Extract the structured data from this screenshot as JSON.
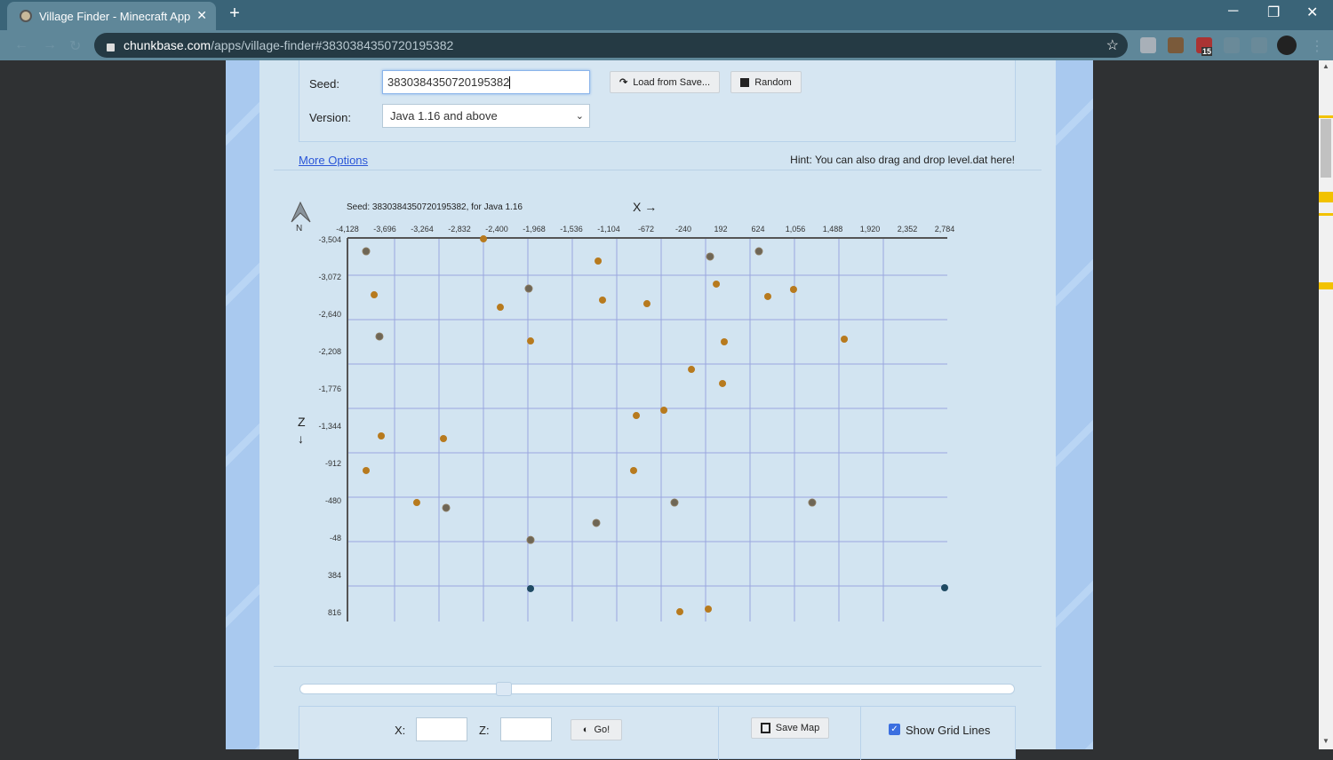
{
  "browser": {
    "tab_title": "Village Finder - Minecraft App",
    "tab_close": "✕",
    "new_tab": "+",
    "url_host": "chunkbase.com",
    "url_path": "/apps/village-finder#3830384350720195382",
    "extension_badge": "15",
    "window_controls": {
      "minimize": "─",
      "restore": "❐",
      "close": "✕"
    }
  },
  "form": {
    "seed_label": "Seed:",
    "seed_value": "3830384350720195382",
    "version_label": "Version:",
    "version_value": "Java 1.16 and above",
    "load_button": "Load from Save...",
    "random_button": "Random",
    "more_options": "More Options",
    "hint": "Hint: You can also drag and drop level.dat here!"
  },
  "chart_data": {
    "type": "scatter",
    "title": "Seed: 3830384350720195382, for Java 1.16",
    "xlabel": "X →",
    "ylabel": "Z ↓",
    "compass": "N",
    "x_ticks": [
      -4128,
      -3696,
      -3264,
      -2832,
      -2400,
      -1968,
      -1536,
      -1104,
      -672,
      -240,
      192,
      624,
      1056,
      1488,
      1920,
      2352,
      2784
    ],
    "z_ticks": [
      -3504,
      -3072,
      -2640,
      -2208,
      -1776,
      -1344,
      -912,
      -480,
      -48,
      384,
      816
    ],
    "xlim": [
      -4128,
      2784
    ],
    "zlim": [
      -3504,
      902
    ],
    "grid": true,
    "colors": {
      "village": "#b77a1e",
      "abandoned": "#6e6656",
      "blue": "#1f4a63",
      "grid": "#9aa6de"
    },
    "points": [
      {
        "x": -3912,
        "z": -3370,
        "type": "abandoned"
      },
      {
        "x": -3819,
        "z": -2866,
        "type": "village"
      },
      {
        "x": -3758,
        "z": -2383,
        "type": "abandoned"
      },
      {
        "x": -3737,
        "z": -1231,
        "type": "village"
      },
      {
        "x": -3912,
        "z": -830,
        "type": "village"
      },
      {
        "x": -3326,
        "z": -459,
        "type": "village"
      },
      {
        "x": -3017,
        "z": -1200,
        "type": "village"
      },
      {
        "x": -2986,
        "z": -398,
        "type": "abandoned"
      },
      {
        "x": -2554,
        "z": -3514,
        "type": "village"
      },
      {
        "x": -2359,
        "z": -2722,
        "type": "village"
      },
      {
        "x": -2030,
        "z": -2938,
        "type": "abandoned"
      },
      {
        "x": -2009,
        "z": -2331,
        "type": "village"
      },
      {
        "x": -2009,
        "z": -26,
        "type": "abandoned"
      },
      {
        "x": -2009,
        "z": 538,
        "type": "blue"
      },
      {
        "x": -1227,
        "z": -3257,
        "type": "village"
      },
      {
        "x": -1176,
        "z": -2805,
        "type": "village"
      },
      {
        "x": -1248,
        "z": -223,
        "type": "abandoned"
      },
      {
        "x": -785,
        "z": -1467,
        "type": "village"
      },
      {
        "x": -816,
        "z": -830,
        "type": "village"
      },
      {
        "x": -662,
        "z": -2763,
        "type": "village"
      },
      {
        "x": -466,
        "z": -1529,
        "type": "village"
      },
      {
        "x": -343,
        "z": -459,
        "type": "abandoned"
      },
      {
        "x": -281,
        "z": 806,
        "type": "village"
      },
      {
        "x": -147,
        "z": -2002,
        "type": "village"
      },
      {
        "x": 48,
        "z": 775,
        "type": "village"
      },
      {
        "x": 69,
        "z": -3309,
        "type": "abandoned"
      },
      {
        "x": 141,
        "z": -2990,
        "type": "village"
      },
      {
        "x": 233,
        "z": -2321,
        "type": "village"
      },
      {
        "x": 213,
        "z": -1838,
        "type": "village"
      },
      {
        "x": 634,
        "z": -3370,
        "type": "abandoned"
      },
      {
        "x": 737,
        "z": -2846,
        "type": "village"
      },
      {
        "x": 1035,
        "z": -2928,
        "type": "village"
      },
      {
        "x": 1251,
        "z": -459,
        "type": "abandoned"
      },
      {
        "x": 1622,
        "z": -2352,
        "type": "village"
      },
      {
        "x": 2784,
        "z": 528,
        "type": "blue"
      }
    ]
  },
  "controls": {
    "zoom_slider_percent": 28,
    "x_label": "X:",
    "z_label": "Z:",
    "x_value": "",
    "z_value": "",
    "go_button": "Go!",
    "save_map": "Save Map",
    "show_grid_label": "Show Grid Lines",
    "show_grid_checked": true
  }
}
